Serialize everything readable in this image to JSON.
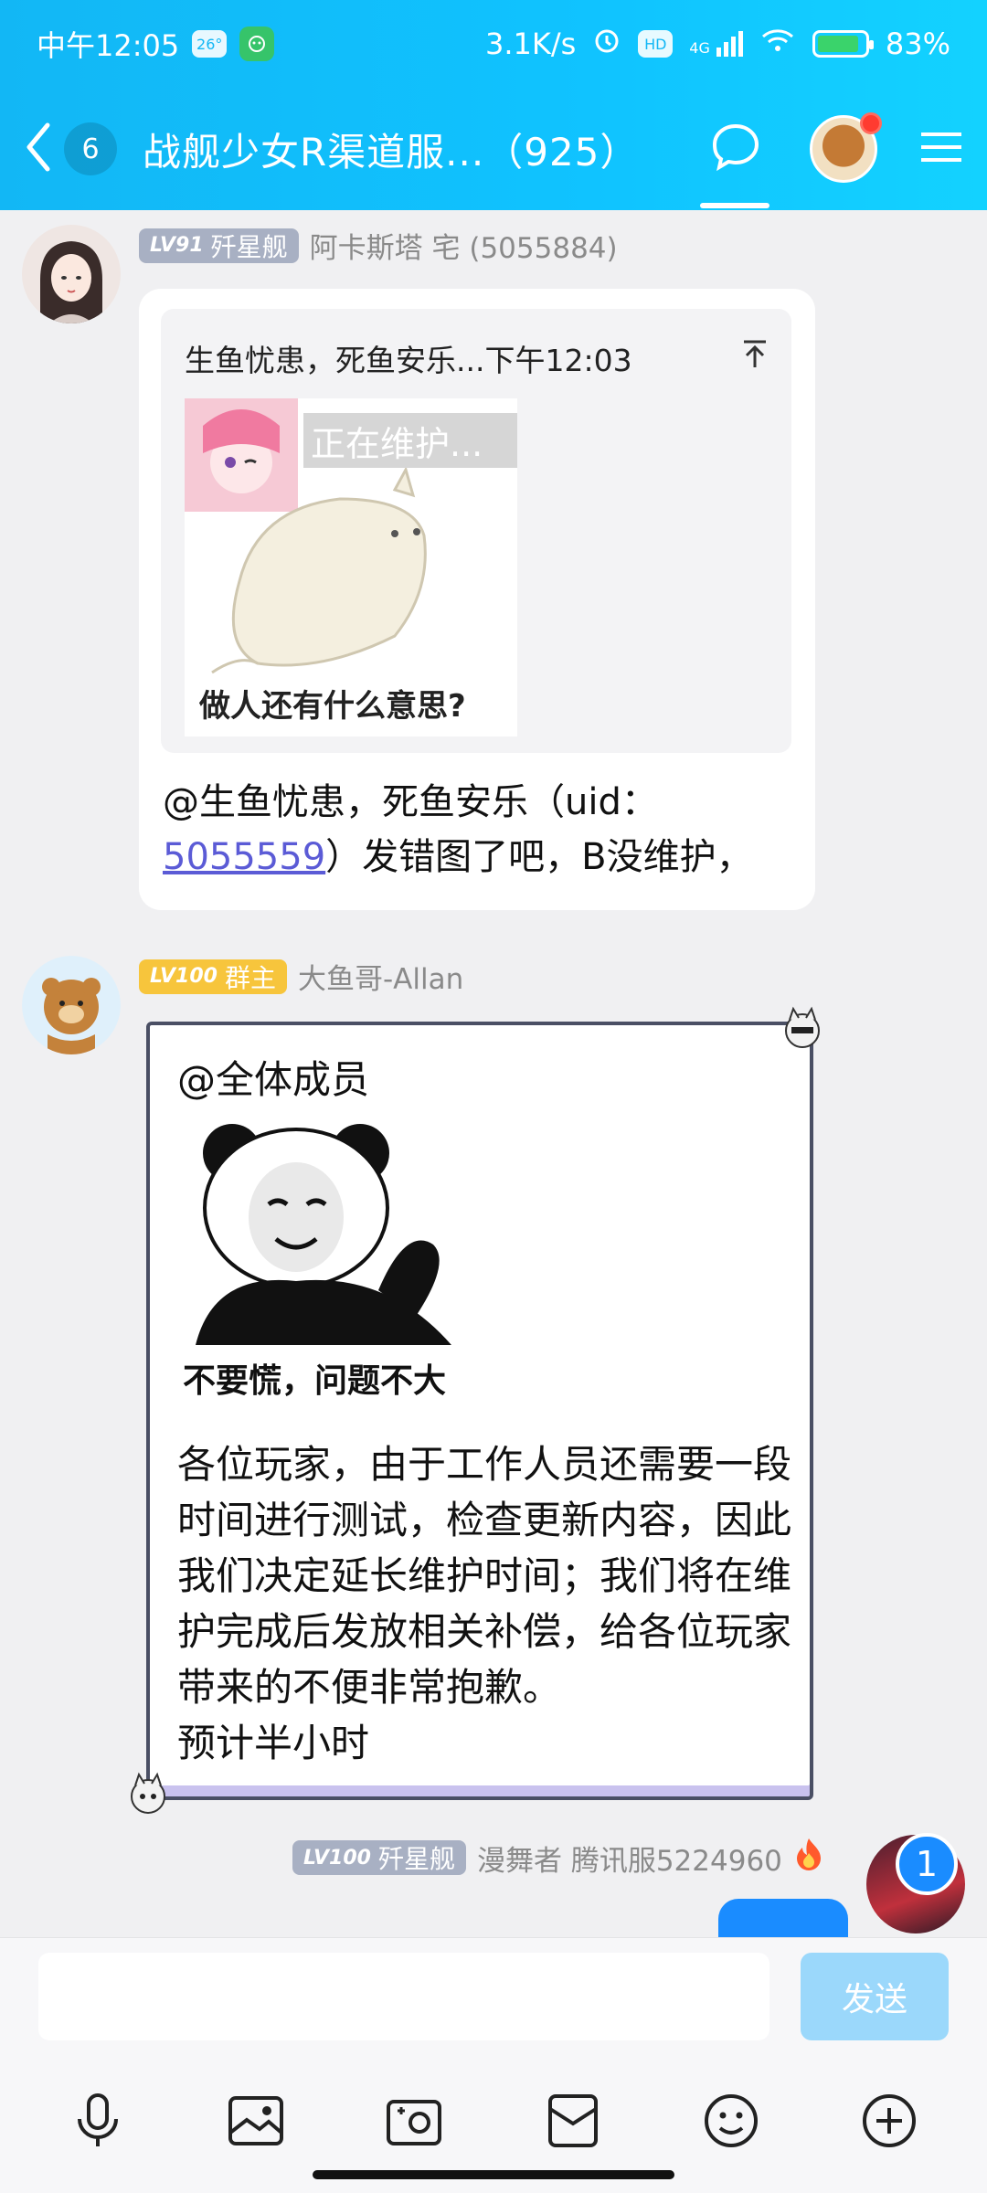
{
  "status_bar": {
    "time": "中午12:05",
    "weather_temp": "26°",
    "network_speed": "3.1K/s",
    "hd_label": "HD",
    "signal_label": "4G",
    "battery": "83%",
    "battery_level": 0.83
  },
  "header": {
    "unread_count": "6",
    "title": "战舰少女R渠道服...（925）",
    "icons": [
      "back-icon",
      "chat-bubble-icon",
      "menu-icon"
    ]
  },
  "messages": [
    {
      "level": "LV91",
      "title": "歼星舰",
      "sender": "阿卡斯塔 宅 (5055884)",
      "quote": {
        "header": "生鱼忧患，死鱼安乐...下午12:03",
        "image_label": "正在维护...",
        "image_caption": "做人还有什么意思?"
      },
      "text_before": "@生鱼忧患，死鱼安乐（uid：",
      "uid_link": "5055559",
      "text_after": "）发错图了吧，B没维护，"
    },
    {
      "level": "LV100",
      "title": "群主",
      "sender": "大鱼哥-Allan",
      "mention": "@全体成员",
      "sticker_caption": "不要慌，问题不大",
      "body": "各位玩家，由于工作人员还需要一段时间进行测试，检查更新内容，因此我们决定延长维护时间；我们将在维护完成后发放相关补偿，给各位玩家带来的不便非常抱歉。\n预计半小时"
    },
    {
      "level": "LV100",
      "title": "歼星舰",
      "sender": "漫舞者 腾讯服5224960",
      "badge_count": "1"
    }
  ],
  "input_bar": {
    "placeholder": "",
    "send_label": "发送",
    "tools": [
      "microphone-icon",
      "image-icon",
      "camera-icon",
      "red-packet-icon",
      "emoji-icon",
      "plus-icon"
    ]
  }
}
